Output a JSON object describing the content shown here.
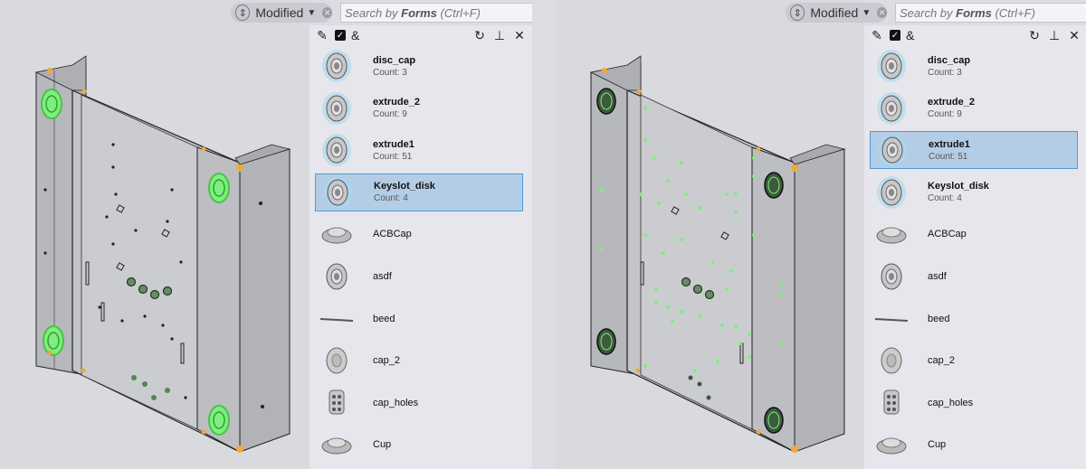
{
  "colors": {
    "highlight": "#7cf07c",
    "selection_bg": "#b4cde6",
    "selection_border": "#4f9bd8",
    "accent_orange": "#f0a93a"
  },
  "left": {
    "filter": {
      "label": "Modified",
      "icon": "filter-icon"
    },
    "search": {
      "prefix": "Search by ",
      "bold": "Forms",
      "shortcut": " (Ctrl+F)"
    },
    "toolbar": {
      "amp": "&"
    },
    "items": [
      {
        "name": "disc_cap",
        "count": "Count: 3",
        "bold": true,
        "selected": false,
        "icon": "disc-cap-icon"
      },
      {
        "name": "extrude_2",
        "count": "Count: 9",
        "bold": true,
        "selected": false,
        "icon": "extrude-icon"
      },
      {
        "name": "extrude1",
        "count": "Count: 51",
        "bold": true,
        "selected": false,
        "icon": "extrude-icon"
      },
      {
        "name": "Keyslot_disk",
        "count": "Count: 4",
        "bold": true,
        "selected": true,
        "icon": "keyslot-icon"
      },
      {
        "name": "ACBCap",
        "count": "",
        "bold": false,
        "selected": false,
        "icon": "acbcap-icon"
      },
      {
        "name": "asdf",
        "count": "",
        "bold": false,
        "selected": false,
        "icon": "asdf-icon"
      },
      {
        "name": "beed",
        "count": "",
        "bold": false,
        "selected": false,
        "icon": "beed-icon"
      },
      {
        "name": "cap_2",
        "count": "",
        "bold": false,
        "selected": false,
        "icon": "cap-icon"
      },
      {
        "name": "cap_holes",
        "count": "",
        "bold": false,
        "selected": false,
        "icon": "cap-holes-icon"
      },
      {
        "name": "Cup",
        "count": "",
        "bold": false,
        "selected": false,
        "icon": "cup-icon"
      }
    ]
  },
  "right": {
    "filter": {
      "label": "Modified",
      "icon": "filter-icon"
    },
    "search": {
      "prefix": "Search by ",
      "bold": "Forms",
      "shortcut": " (Ctrl+F)"
    },
    "toolbar": {
      "amp": "&"
    },
    "items": [
      {
        "name": "disc_cap",
        "count": "Count: 3",
        "bold": true,
        "selected": false,
        "icon": "disc-cap-icon"
      },
      {
        "name": "extrude_2",
        "count": "Count: 9",
        "bold": true,
        "selected": false,
        "icon": "extrude-icon"
      },
      {
        "name": "extrude1",
        "count": "Count: 51",
        "bold": true,
        "selected": true,
        "icon": "extrude-icon"
      },
      {
        "name": "Keyslot_disk",
        "count": "Count: 4",
        "bold": true,
        "selected": false,
        "icon": "keyslot-icon"
      },
      {
        "name": "ACBCap",
        "count": "",
        "bold": false,
        "selected": false,
        "icon": "acbcap-icon"
      },
      {
        "name": "asdf",
        "count": "",
        "bold": false,
        "selected": false,
        "icon": "asdf-icon"
      },
      {
        "name": "beed",
        "count": "",
        "bold": false,
        "selected": false,
        "icon": "beed-icon"
      },
      {
        "name": "cap_2",
        "count": "",
        "bold": false,
        "selected": false,
        "icon": "cap-icon"
      },
      {
        "name": "cap_holes",
        "count": "",
        "bold": false,
        "selected": false,
        "icon": "cap-holes-icon"
      },
      {
        "name": "Cup",
        "count": "",
        "bold": false,
        "selected": false,
        "icon": "cup-icon"
      }
    ]
  }
}
